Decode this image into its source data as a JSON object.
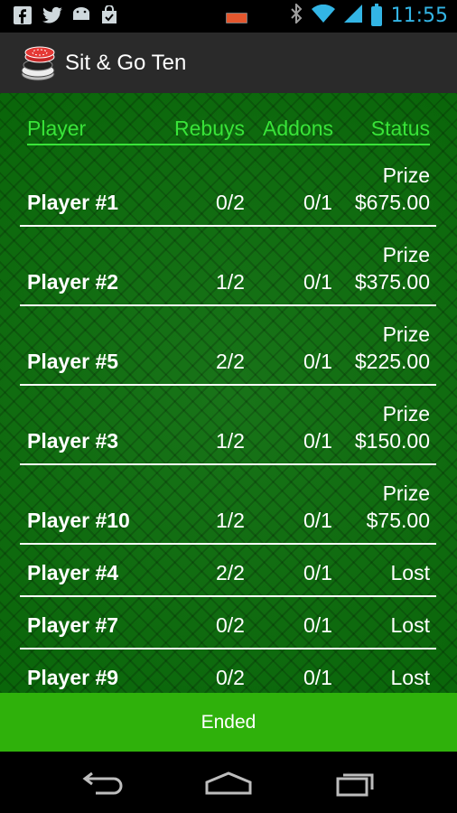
{
  "status_bar": {
    "time": "11:55",
    "left_icons": [
      "facebook-icon",
      "twitter-icon",
      "android-icon",
      "shopping-bag-icon"
    ],
    "right_icons": [
      "bluetooth-icon",
      "wifi-icon",
      "signal-icon",
      "battery-icon"
    ]
  },
  "action_bar": {
    "title": "Sit & Go Ten",
    "icon": "poker-chips-icon"
  },
  "table": {
    "headers": {
      "player": "Player",
      "rebuys": "Rebuys",
      "addons": "Addons",
      "status": "Status"
    },
    "rows": [
      {
        "player": "Player #1",
        "rebuys": "0/2",
        "addons": "0/1",
        "status_label": "Prize",
        "status": "$675.00"
      },
      {
        "player": "Player #2",
        "rebuys": "1/2",
        "addons": "0/1",
        "status_label": "Prize",
        "status": "$375.00"
      },
      {
        "player": "Player #5",
        "rebuys": "2/2",
        "addons": "0/1",
        "status_label": "Prize",
        "status": "$225.00"
      },
      {
        "player": "Player #3",
        "rebuys": "1/2",
        "addons": "0/1",
        "status_label": "Prize",
        "status": "$150.00"
      },
      {
        "player": "Player #10",
        "rebuys": "1/2",
        "addons": "0/1",
        "status_label": "Prize",
        "status": "$75.00"
      },
      {
        "player": "Player #4",
        "rebuys": "2/2",
        "addons": "0/1",
        "status_label": "",
        "status": "Lost"
      },
      {
        "player": "Player #7",
        "rebuys": "0/2",
        "addons": "0/1",
        "status_label": "",
        "status": "Lost"
      },
      {
        "player": "Player #9",
        "rebuys": "0/2",
        "addons": "0/1",
        "status_label": "",
        "status": "Lost"
      }
    ]
  },
  "footer_button": {
    "label": "Ended"
  },
  "nav_bar": {
    "buttons": [
      "back-icon",
      "home-icon",
      "recent-apps-icon"
    ]
  },
  "colors": {
    "felt_green": "#0a6b0a",
    "header_green": "#39e339",
    "button_green": "#2fb10b",
    "clock_blue": "#33b5e5"
  }
}
